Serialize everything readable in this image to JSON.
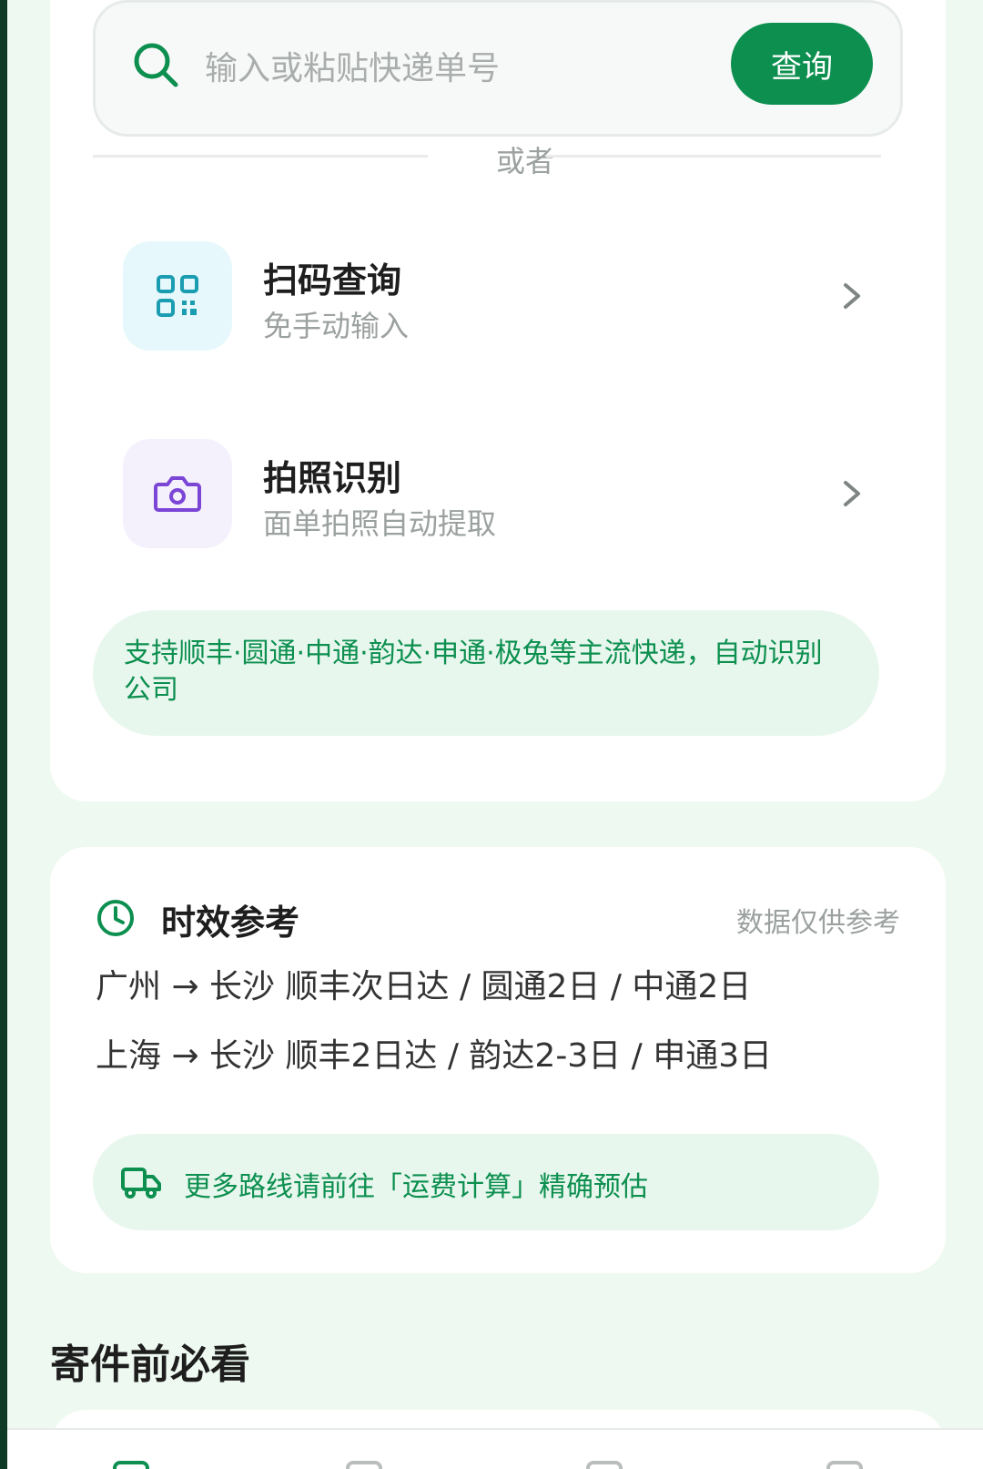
{
  "search": {
    "placeholder": "输入或粘贴快递单号",
    "button_label": "查询"
  },
  "divider": {
    "label": "或者"
  },
  "options": [
    {
      "title": "扫码查询",
      "subtitle": "免手动输入",
      "icon": "qr-code-icon",
      "icon_bg": "#e6f8fb",
      "icon_color": "#1a9db0"
    },
    {
      "title": "拍照识别",
      "subtitle": "面单拍照自动提取",
      "icon": "camera-icon",
      "icon_bg": "#f4f1fd",
      "icon_color": "#7b45d6"
    }
  ],
  "support_note": "支持顺丰·圆通·中通·韵达·申通·极兔等主流快递，自动识别公司",
  "timing": {
    "title": "时效参考",
    "note": "数据仅供参考",
    "routes": [
      "广州 → 长沙   顺丰次日达 / 圆通2日 / 中通2日",
      "上海 → 长沙   顺丰2日达 / 韵达2-3日 / 申通3日"
    ],
    "more": "更多路线请前往「运费计算」精确预估"
  },
  "section": {
    "title": "寄件前必看"
  },
  "colors": {
    "accent": "#0c8f4f",
    "background": "#eef9f1",
    "soft_green": "#e8f7ee"
  }
}
